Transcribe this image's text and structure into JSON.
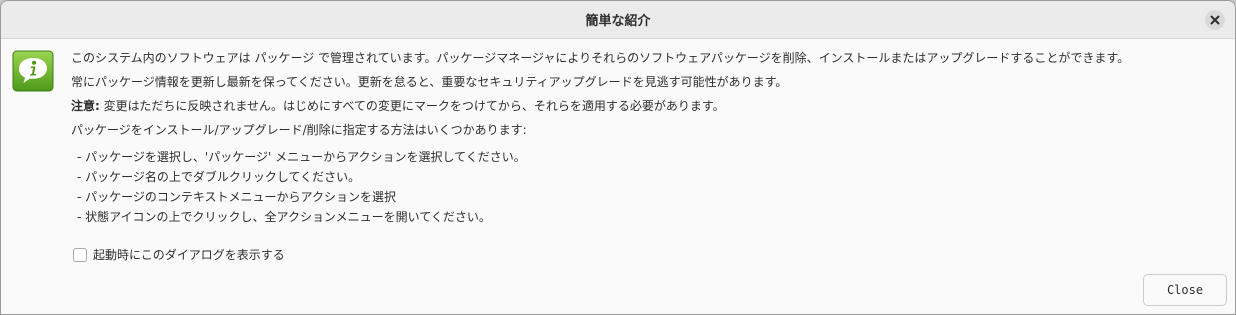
{
  "window": {
    "title": "簡単な紹介"
  },
  "intro": {
    "line1": "このシステム内のソフトウェアは パッケージ で管理されています。パッケージマネージャによりそれらのソフトウェアパッケージを削除、インストールまたはアップグレードすることができます。",
    "line2": "常にパッケージ情報を更新し最新を保ってください。更新を怠ると、重要なセキュリティアップグレードを見逃す可能性があります。",
    "note_label": "注意:",
    "note_text": "変更はただちに反映されません。はじめにすべての変更にマークをつけてから、それらを適用する必要があります。",
    "methods_heading": "パッケージをインストール/アップグレード/削除に指定する方法はいくつかあります:",
    "methods": [
      "-  パッケージを選択し、'パッケージ' メニューからアクションを選択してください。",
      "-  パッケージ名の上でダブルクリックしてください。",
      "-  パッケージのコンテキストメニューからアクションを選択",
      "-  状態アイコンの上でクリックし、全アクションメニューを開いてください。"
    ]
  },
  "startup_checkbox": {
    "label": "起動時にこのダイアログを表示する",
    "checked": false
  },
  "buttons": {
    "close": "Close"
  },
  "icons": {
    "info": "info-bubble-icon",
    "close": "close-icon"
  },
  "colors": {
    "info_green": "#6fb32e",
    "titlebar": "#ebebeb",
    "background": "#fafafa"
  }
}
